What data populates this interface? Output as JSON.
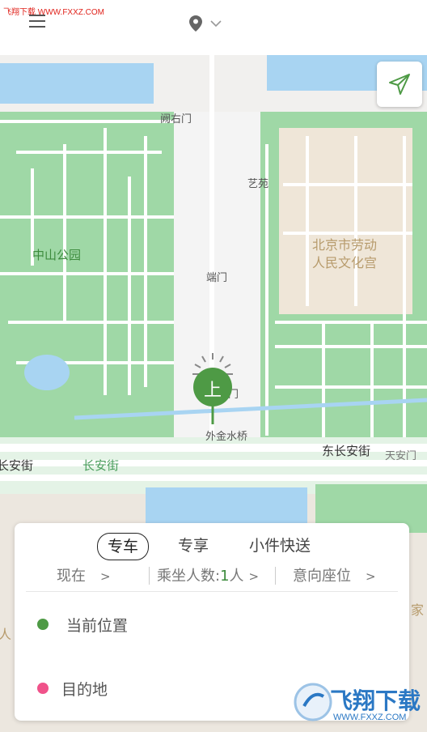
{
  "watermark": {
    "top_text": "飞翔下载 WWW.FXXZ.COM",
    "logo_text": "飞翔下载",
    "logo_url": "WWW.FXXZ.COM"
  },
  "header": {
    "menu_icon": "menu-icon",
    "location_icon": "location-pin-icon",
    "dropdown_icon": "chevron-down-icon"
  },
  "map": {
    "labels": {
      "queyoumen": "阙右门",
      "yiyuan": "艺苑",
      "zhongshan_park": "中山公园",
      "palace_line1": "北京市劳动",
      "palace_line2": "人民文化宫",
      "duanmen": "端门",
      "waijinshui": "外金水桥",
      "changan_left": "长安街",
      "changan_mid": "长安街",
      "dongchangan": "东长安街",
      "tiananmen": "天安门",
      "jia": "家",
      "ren": "人",
      "gate_partial": "门"
    },
    "pickup_pin_label": "上",
    "nav_icon": "navigation-arrow-icon",
    "colors": {
      "park": "#9fd8a6",
      "water": "#a8d4f2",
      "road": "#ffffff",
      "palace": "#efe6d8",
      "pin": "#4e9a45"
    }
  },
  "panel": {
    "tabs": [
      {
        "label": "专车",
        "active": true
      },
      {
        "label": "专享",
        "active": false
      },
      {
        "label": "小件快送",
        "active": false
      }
    ],
    "time": {
      "label": "现在",
      "chevron": ">"
    },
    "passengers": {
      "prefix": "乘坐人数:",
      "count": "1",
      "suffix": "人",
      "chevron": ">"
    },
    "seat": {
      "label": "意向座位",
      "chevron": ">"
    },
    "origin": {
      "label": "当前位置",
      "color": "#4e9a45"
    },
    "destination": {
      "label": "目的地",
      "color": "#f0528a"
    }
  }
}
